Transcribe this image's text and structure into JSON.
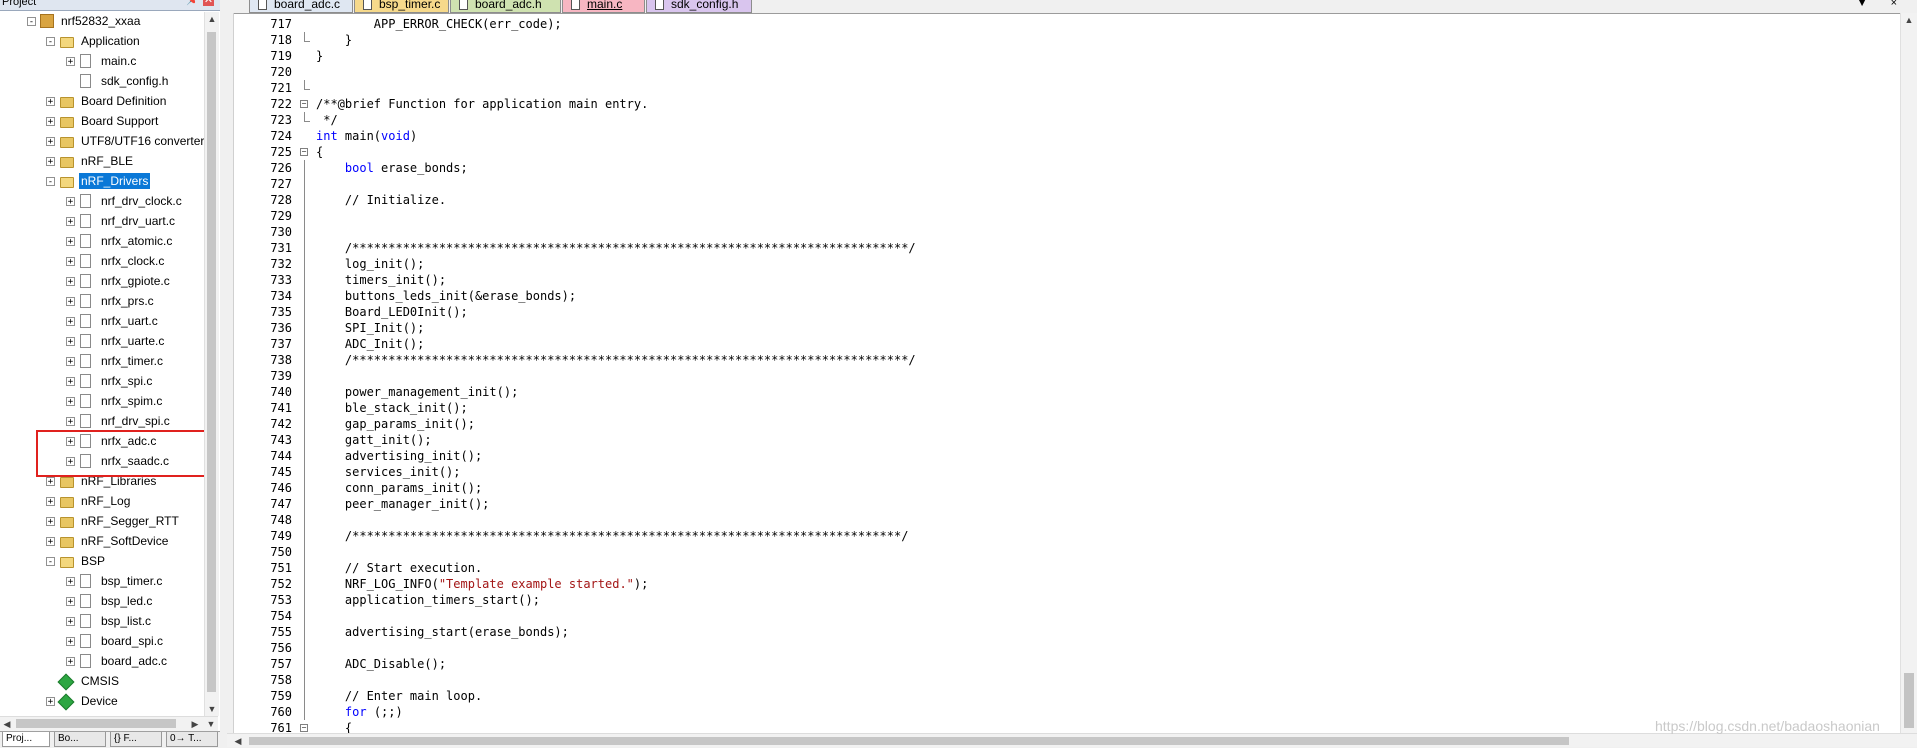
{
  "project_pane": {
    "title": "Project",
    "tree": [
      {
        "label": "nrf52832_xxaa",
        "level": 0,
        "kind": "root",
        "toggle": "-"
      },
      {
        "label": "Application",
        "level": 1,
        "kind": "folder-open",
        "toggle": "-"
      },
      {
        "label": "main.c",
        "level": 2,
        "kind": "file",
        "toggle": "+"
      },
      {
        "label": "sdk_config.h",
        "level": 2,
        "kind": "file",
        "toggle": ""
      },
      {
        "label": "Board Definition",
        "level": 1,
        "kind": "folder",
        "toggle": "+"
      },
      {
        "label": "Board Support",
        "level": 1,
        "kind": "folder",
        "toggle": "+"
      },
      {
        "label": "UTF8/UTF16 converter",
        "level": 1,
        "kind": "folder",
        "toggle": "+"
      },
      {
        "label": "nRF_BLE",
        "level": 1,
        "kind": "folder",
        "toggle": "+"
      },
      {
        "label": "nRF_Drivers",
        "level": 1,
        "kind": "folder-open",
        "toggle": "-",
        "selected": true
      },
      {
        "label": "nrf_drv_clock.c",
        "level": 2,
        "kind": "file-link",
        "toggle": "+"
      },
      {
        "label": "nrf_drv_uart.c",
        "level": 2,
        "kind": "file-link",
        "toggle": "+"
      },
      {
        "label": "nrfx_atomic.c",
        "level": 2,
        "kind": "file-link",
        "toggle": "+"
      },
      {
        "label": "nrfx_clock.c",
        "level": 2,
        "kind": "file",
        "toggle": "+"
      },
      {
        "label": "nrfx_gpiote.c",
        "level": 2,
        "kind": "file-link",
        "toggle": "+"
      },
      {
        "label": "nrfx_prs.c",
        "level": 2,
        "kind": "file-link",
        "toggle": "+"
      },
      {
        "label": "nrfx_uart.c",
        "level": 2,
        "kind": "file",
        "toggle": "+"
      },
      {
        "label": "nrfx_uarte.c",
        "level": 2,
        "kind": "file-link",
        "toggle": "+"
      },
      {
        "label": "nrfx_timer.c",
        "level": 2,
        "kind": "file",
        "toggle": "+"
      },
      {
        "label": "nrfx_spi.c",
        "level": 2,
        "kind": "file",
        "toggle": "+"
      },
      {
        "label": "nrfx_spim.c",
        "level": 2,
        "kind": "file",
        "toggle": "+"
      },
      {
        "label": "nrf_drv_spi.c",
        "level": 2,
        "kind": "file",
        "toggle": "+"
      },
      {
        "label": "nrfx_adc.c",
        "level": 2,
        "kind": "file",
        "toggle": "+",
        "highlight": true
      },
      {
        "label": "nrfx_saadc.c",
        "level": 2,
        "kind": "file",
        "toggle": "+",
        "highlight": true
      },
      {
        "label": "nRF_Libraries",
        "level": 1,
        "kind": "folder",
        "toggle": "+"
      },
      {
        "label": "nRF_Log",
        "level": 1,
        "kind": "folder",
        "toggle": "+"
      },
      {
        "label": "nRF_Segger_RTT",
        "level": 1,
        "kind": "folder",
        "toggle": "+"
      },
      {
        "label": "nRF_SoftDevice",
        "level": 1,
        "kind": "folder",
        "toggle": "+"
      },
      {
        "label": "BSP",
        "level": 1,
        "kind": "folder-open",
        "toggle": "-"
      },
      {
        "label": "bsp_timer.c",
        "level": 2,
        "kind": "file",
        "toggle": "+"
      },
      {
        "label": "bsp_led.c",
        "level": 2,
        "kind": "file",
        "toggle": "+"
      },
      {
        "label": "bsp_list.c",
        "level": 2,
        "kind": "file",
        "toggle": "+"
      },
      {
        "label": "board_spi.c",
        "level": 2,
        "kind": "file",
        "toggle": "+"
      },
      {
        "label": "board_adc.c",
        "level": 2,
        "kind": "file",
        "toggle": "+"
      },
      {
        "label": "CMSIS",
        "level": 1,
        "kind": "component",
        "toggle": ""
      },
      {
        "label": "Device",
        "level": 1,
        "kind": "component",
        "toggle": "+"
      }
    ],
    "bottom_tabs": [
      "Proj...",
      "Bo...",
      "{} F...",
      "0→ T..."
    ]
  },
  "editor": {
    "tabs": [
      {
        "label": "board_adc.c",
        "color": "#dfe7f2",
        "active": false
      },
      {
        "label": "bsp_timer.c",
        "color": "#f6d98b",
        "active": false
      },
      {
        "label": "board_adc.h",
        "color": "#cfe2b0",
        "active": false
      },
      {
        "label": "main.c",
        "color": "#f7b6c2",
        "active": true
      },
      {
        "label": "sdk_config.h",
        "color": "#d9c5ee",
        "active": false
      }
    ],
    "tab_controls": "▼ ×",
    "lines": [
      {
        "n": "717",
        "fold": "",
        "text": "        APP_ERROR_CHECK(err_code);"
      },
      {
        "n": "718",
        "fold": "end",
        "text": "    }"
      },
      {
        "n": "719",
        "fold": "",
        "text": "}"
      },
      {
        "n": "720",
        "fold": "",
        "text": ""
      },
      {
        "n": "721",
        "fold": "end",
        "text": ""
      },
      {
        "n": "722",
        "fold": "-",
        "text": "/**@brief Function for application main entry.",
        "style": "comment"
      },
      {
        "n": "723",
        "fold": "end",
        "text": " */",
        "style": "comment"
      },
      {
        "n": "724",
        "fold": "",
        "text": "int main(void)",
        "style": "main"
      },
      {
        "n": "725",
        "fold": "-",
        "text": "{"
      },
      {
        "n": "726",
        "fold": "line",
        "text": "    bool erase_bonds;",
        "style": "bool"
      },
      {
        "n": "727",
        "fold": "line",
        "text": ""
      },
      {
        "n": "728",
        "fold": "line",
        "text": "    // Initialize.",
        "style": "comment"
      },
      {
        "n": "729",
        "fold": "line",
        "text": ""
      },
      {
        "n": "730",
        "fold": "line",
        "text": ""
      },
      {
        "n": "731",
        "fold": "line",
        "text": "    /*****************************************************************************/",
        "style": "comment"
      },
      {
        "n": "732",
        "fold": "line",
        "text": "    log_init();"
      },
      {
        "n": "733",
        "fold": "line",
        "text": "    timers_init();"
      },
      {
        "n": "734",
        "fold": "line",
        "text": "    buttons_leds_init(&erase_bonds);"
      },
      {
        "n": "735",
        "fold": "line",
        "text": "    Board_LED0Init();"
      },
      {
        "n": "736",
        "fold": "line",
        "text": "    SPI_Init();"
      },
      {
        "n": "737",
        "fold": "line",
        "text": "    ADC_Init();"
      },
      {
        "n": "738",
        "fold": "line",
        "text": "    /*****************************************************************************/",
        "style": "comment"
      },
      {
        "n": "739",
        "fold": "line",
        "text": ""
      },
      {
        "n": "740",
        "fold": "line",
        "text": "    power_management_init();"
      },
      {
        "n": "741",
        "fold": "line",
        "text": "    ble_stack_init();"
      },
      {
        "n": "742",
        "fold": "line",
        "text": "    gap_params_init();"
      },
      {
        "n": "743",
        "fold": "line",
        "text": "    gatt_init();"
      },
      {
        "n": "744",
        "fold": "line",
        "text": "    advertising_init();"
      },
      {
        "n": "745",
        "fold": "line",
        "text": "    services_init();"
      },
      {
        "n": "746",
        "fold": "line",
        "text": "    conn_params_init();"
      },
      {
        "n": "747",
        "fold": "line",
        "text": "    peer_manager_init();"
      },
      {
        "n": "748",
        "fold": "line",
        "text": ""
      },
      {
        "n": "749",
        "fold": "line",
        "text": "    /****************************************************************************/",
        "style": "comment"
      },
      {
        "n": "750",
        "fold": "line",
        "text": ""
      },
      {
        "n": "751",
        "fold": "line",
        "text": "    // Start execution.",
        "style": "comment"
      },
      {
        "n": "752",
        "fold": "line",
        "text": "    NRF_LOG_INFO(\"Template example started.\");",
        "style": "log"
      },
      {
        "n": "753",
        "fold": "line",
        "text": "    application_timers_start();"
      },
      {
        "n": "754",
        "fold": "line",
        "text": ""
      },
      {
        "n": "755",
        "fold": "line",
        "text": "    advertising_start(erase_bonds);"
      },
      {
        "n": "756",
        "fold": "line",
        "text": ""
      },
      {
        "n": "757",
        "fold": "line",
        "text": "    ADC_Disable();"
      },
      {
        "n": "758",
        "fold": "line",
        "text": ""
      },
      {
        "n": "759",
        "fold": "line",
        "text": "    // Enter main loop.",
        "style": "comment"
      },
      {
        "n": "760",
        "fold": "line",
        "text": "    for (;;)",
        "style": "for"
      },
      {
        "n": "761",
        "fold": "-",
        "text": "    {"
      }
    ]
  },
  "watermark": "https://blog.csdn.net/badaoshaonian",
  "colors": {
    "selection": "#0a78d7",
    "highlight_box": "#e0211e",
    "keyword": "#0000ff",
    "comment": "#008000",
    "string": "#a31515"
  }
}
